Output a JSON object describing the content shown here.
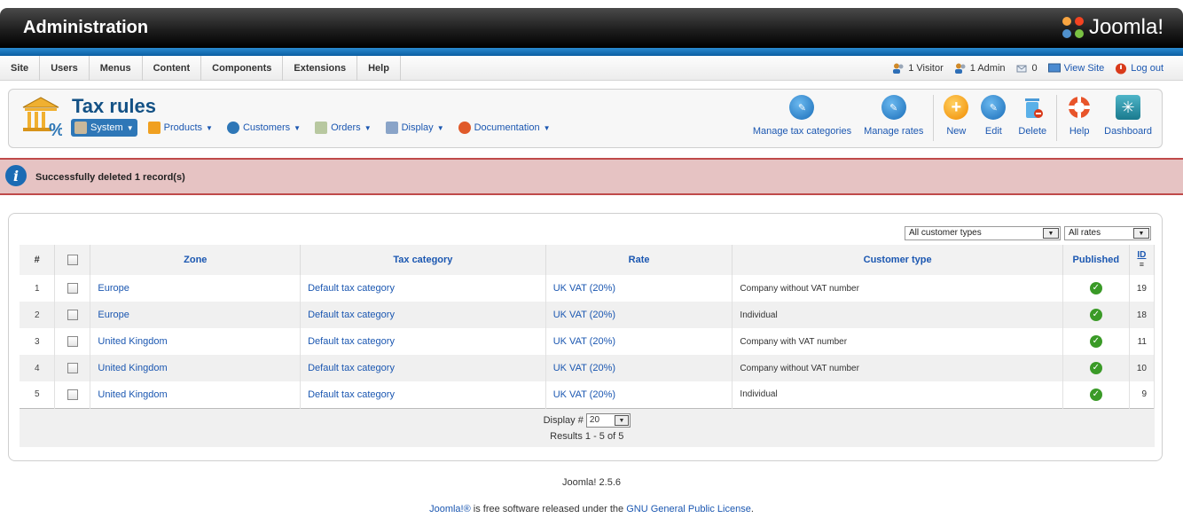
{
  "header": {
    "title": "Administration",
    "brand": "Joomla!"
  },
  "menubar": {
    "items": [
      "Site",
      "Users",
      "Menus",
      "Content",
      "Components",
      "Extensions",
      "Help"
    ],
    "status": {
      "visitors": "1 Visitor",
      "admins": "1 Admin",
      "messages": "0",
      "view_site": "View Site",
      "logout": "Log out"
    }
  },
  "toolbar": {
    "page_title": "Tax rules",
    "submenu": [
      {
        "label": "System",
        "color": "#7a6a5a",
        "active": true
      },
      {
        "label": "Products",
        "color": "#f0a020"
      },
      {
        "label": "Customers",
        "color": "#2e77b7"
      },
      {
        "label": "Orders",
        "color": "#8a9a6a"
      },
      {
        "label": "Display",
        "color": "#5a7aaa"
      },
      {
        "label": "Documentation",
        "color": "#e05a2a"
      }
    ],
    "buttons": {
      "manage_tax_categories": "Manage tax categories",
      "manage_rates": "Manage rates",
      "new": "New",
      "edit": "Edit",
      "delete": "Delete",
      "help": "Help",
      "dashboard": "Dashboard"
    }
  },
  "message": {
    "text": "Successfully deleted 1 record(s)"
  },
  "filters": {
    "customer_type": "All customer types",
    "rates": "All rates"
  },
  "table": {
    "columns": {
      "num": "#",
      "zone": "Zone",
      "tax_category": "Tax category",
      "rate": "Rate",
      "customer_type": "Customer type",
      "published": "Published",
      "id": "ID"
    },
    "rows": [
      {
        "num": "1",
        "zone": "Europe",
        "tax_category": "Default tax category",
        "rate": "UK VAT (20%)",
        "customer_type": "Company without VAT number",
        "id": "19"
      },
      {
        "num": "2",
        "zone": "Europe",
        "tax_category": "Default tax category",
        "rate": "UK VAT (20%)",
        "customer_type": "Individual",
        "id": "18"
      },
      {
        "num": "3",
        "zone": "United Kingdom",
        "tax_category": "Default tax category",
        "rate": "UK VAT (20%)",
        "customer_type": "Company with VAT number",
        "id": "11"
      },
      {
        "num": "4",
        "zone": "United Kingdom",
        "tax_category": "Default tax category",
        "rate": "UK VAT (20%)",
        "customer_type": "Company without VAT number",
        "id": "10"
      },
      {
        "num": "5",
        "zone": "United Kingdom",
        "tax_category": "Default tax category",
        "rate": "UK VAT (20%)",
        "customer_type": "Individual",
        "id": "9"
      }
    ],
    "footer": {
      "display_label": "Display #",
      "display_value": "20",
      "results": "Results 1 - 5 of 5"
    }
  },
  "footer": {
    "version": "Joomla! 2.5.6",
    "license_prefix": "Joomla!®",
    "license_middle": " is free software released under the ",
    "license_link": "GNU General Public License",
    "license_suffix": "."
  }
}
